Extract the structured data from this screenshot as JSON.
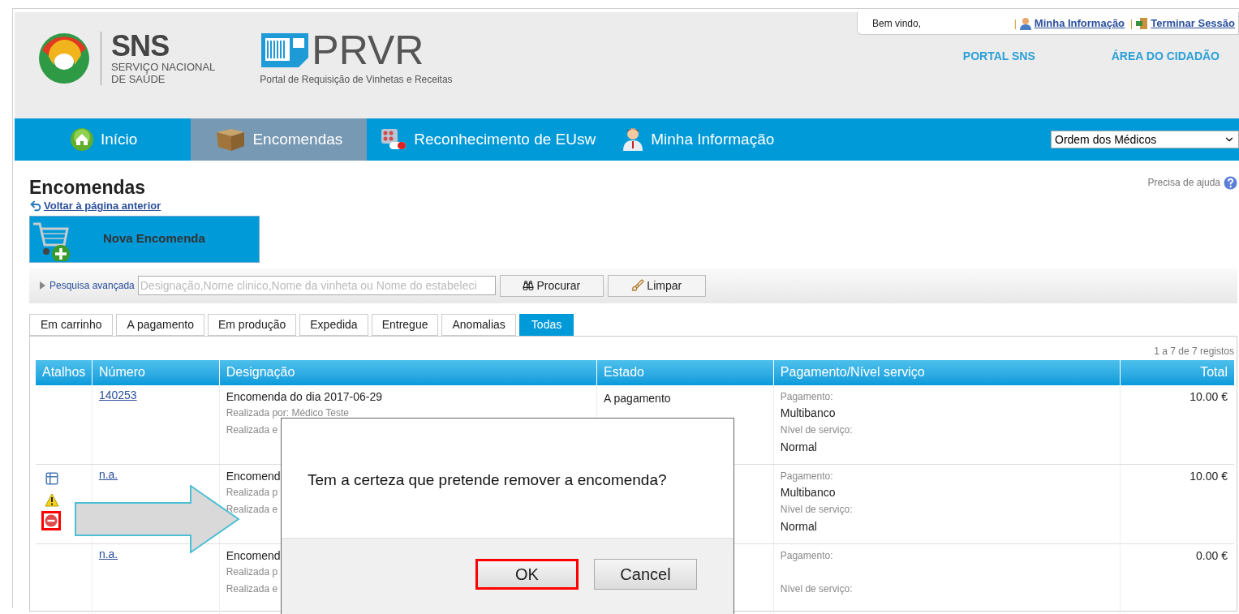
{
  "header": {
    "org_logo": {
      "acronym": "SNS",
      "name_lines": [
        "SERVIÇO NACIONAL",
        "DE SAÚDE"
      ]
    },
    "app_logo": {
      "name": "PRVR",
      "tagline": "Portal de Requisição de Vinhetas e Receitas"
    },
    "welcome": "Bem vindo,",
    "separator": "|",
    "user_links": [
      {
        "label": "Minha Informação",
        "kind": "user"
      },
      {
        "label": "Terminar Sessão",
        "kind": "exit"
      }
    ],
    "portal_links": [
      "PORTAL SNS",
      "ÁREA DO CIDADÃO"
    ]
  },
  "nav": {
    "items": [
      {
        "label": "Início",
        "kind": "home",
        "selected": false
      },
      {
        "label": "Encomendas",
        "kind": "box",
        "selected": true
      },
      {
        "label": "Reconhecimento de EUsw",
        "kind": "pills",
        "selected": false
      },
      {
        "label": "Minha Informação",
        "kind": "doctor",
        "selected": false
      }
    ],
    "select_value": "Ordem dos Médicos"
  },
  "page": {
    "title": "Encomendas",
    "back_link": "Voltar à página anterior",
    "new_button": "Nova Encomenda",
    "help": "Precisa de ajuda"
  },
  "search": {
    "advanced_link": "Pesquisa avançada",
    "placeholder": "Designação,Nome clinico,Nome da vinheta ou Nome do estabeleci",
    "buttons": [
      {
        "label": "Procurar",
        "kind": "search"
      },
      {
        "label": "Limpar",
        "kind": "clear"
      }
    ]
  },
  "status_tabs": [
    {
      "label": "Em carrinho",
      "selected": false
    },
    {
      "label": "A pagamento",
      "selected": false
    },
    {
      "label": "Em produção",
      "selected": false
    },
    {
      "label": "Expedida",
      "selected": false
    },
    {
      "label": "Entregue",
      "selected": false
    },
    {
      "label": "Anomalias",
      "selected": false
    },
    {
      "label": "Todas",
      "selected": true
    }
  ],
  "table": {
    "count": "1 a 7 de 7 registos",
    "columns": [
      "Atalhos",
      "Número",
      "Designação",
      "Estado",
      "Pagamento/Nível serviço",
      "Total"
    ],
    "rows": [
      {
        "shortcuts": [],
        "number": "140253",
        "designation": "Encomenda do dia 2017-06-29",
        "by": "Realizada por: Médico Teste",
        "at": "Realizada e",
        "status": "A pagamento",
        "payment_label": "Pagamento:",
        "payment": "Multibanco",
        "level_label": "Nível de serviço:",
        "level_value": "Normal",
        "total": "10.00 €"
      },
      {
        "shortcuts": [
          {
            "kind": "details",
            "highlighted": false
          },
          {
            "kind": "warning",
            "highlighted": false
          },
          {
            "kind": "remove",
            "highlighted": true
          }
        ],
        "number": "n.a.",
        "designation": "Encomend",
        "by": "Realizada p",
        "at": "Realizada e",
        "payment_label": "Pagamento:",
        "payment": "Multibanco",
        "level_label": "Nível de serviço:",
        "level_value": "Normal",
        "total": "10.00 €"
      },
      {
        "shortcuts": [],
        "number": "n.a.",
        "designation": "Encomend",
        "by": "Realizada p",
        "at": "Realizada e",
        "payment_label": "Pagamento:",
        "level_label": "Nível de serviço:",
        "total": "0.00 €"
      }
    ]
  },
  "dialog": {
    "message": "Tem a certeza que pretende remover a encomenda?",
    "buttons": [
      {
        "label": "OK",
        "highlighted": true
      },
      {
        "label": "Cancel",
        "highlighted": false
      }
    ]
  }
}
